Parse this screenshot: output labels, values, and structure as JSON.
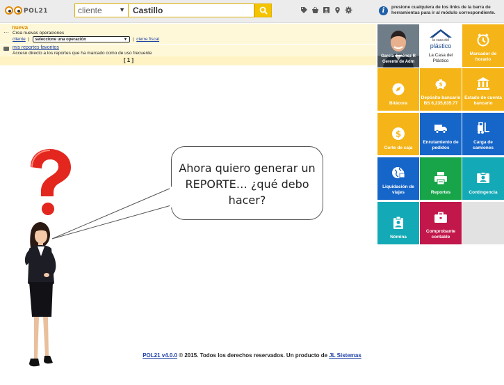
{
  "app": {
    "logo_text": "POL21"
  },
  "search": {
    "type_value": "cliente",
    "query_value": "Castillo"
  },
  "header": {
    "info_text": "presione cualquiera de los links de la barra de herramientas para ir al módulo correspondiente."
  },
  "toolbar_icons": [
    "tag-icon",
    "basket-icon",
    "contact-icon",
    "pin-icon",
    "gear-icon"
  ],
  "panel": {
    "nueva_label": "nueva",
    "crea_text": "Crea nuevas operaciones",
    "cliente_link": "cliente",
    "sep": "|",
    "select_value": "seleccione una operación",
    "cierre_link": "cierre fiscal",
    "fav_link": "mis reportes favoritos",
    "fav_desc": "Acceso directo a los reportes que ha marcado como de uso frecuente",
    "pager": "[ 1 ]"
  },
  "tiles": {
    "profile": {
      "name_line1": "García Jiménez R",
      "name_line2": "Gerente de Adm"
    },
    "company": {
      "brand_small": "la casa del",
      "brand_big": "plástico",
      "name_line1": "La Casa del",
      "name_line2": "Plástico"
    },
    "items": [
      {
        "label1": "Marcador de",
        "label2": "horario",
        "color": "#f5b518",
        "icon": "clock-icon"
      },
      {
        "label1": "Bitácora",
        "label2": "",
        "color": "#f5b518",
        "icon": "compass-icon"
      },
      {
        "label1": "Depósito bancario",
        "label2": "BS 6,235,635.77",
        "color": "#f5b518",
        "icon": "piggybank-icon"
      },
      {
        "label1": "Estado de cuenta",
        "label2": "bancario",
        "color": "#f5b518",
        "icon": "bank-icon"
      },
      {
        "label1": "Corte de caja",
        "label2": "",
        "color": "#f5b518",
        "icon": "coin-icon"
      },
      {
        "label1": "Enrutamiento de",
        "label2": "pedidos",
        "color": "#1665c9",
        "icon": "truck-icon"
      },
      {
        "label1": "Carga de",
        "label2": "camiones",
        "color": "#1665c9",
        "icon": "forklift-icon"
      },
      {
        "label1": "Liquidación de",
        "label2": "viajes",
        "color": "#1665c9",
        "icon": "globe-lock-icon"
      },
      {
        "label1": "Reportes",
        "label2": "",
        "color": "#18a54a",
        "icon": "printer-icon"
      },
      {
        "label1": "Contingencia",
        "label2": "",
        "color": "#14a9b6",
        "icon": "id-card-icon"
      },
      {
        "label1": "Nómina",
        "label2": "",
        "color": "#14a9b6",
        "icon": "badge-icon"
      },
      {
        "label1": "Comprobante",
        "label2": "contable",
        "color": "#c1174a",
        "icon": "briefcase-icon"
      }
    ]
  },
  "bubble": {
    "line1": "Ahora quiero generar un",
    "line2": "REPORTE… ¿qué debo",
    "line3": "hacer?"
  },
  "footer": {
    "version_link": "POL21 v4.0.0",
    "text": " © 2015. Todos los derechos reservados. Un producto de ",
    "company_link": "JL Sistemas"
  },
  "colors": {
    "accent": "#f5c400",
    "yellow_tile": "#f5b518",
    "blue_tile": "#1665c9",
    "green_tile": "#18a54a",
    "teal_tile": "#14a9b6",
    "red_tile": "#c1174a",
    "link": "#1a3ea6"
  }
}
